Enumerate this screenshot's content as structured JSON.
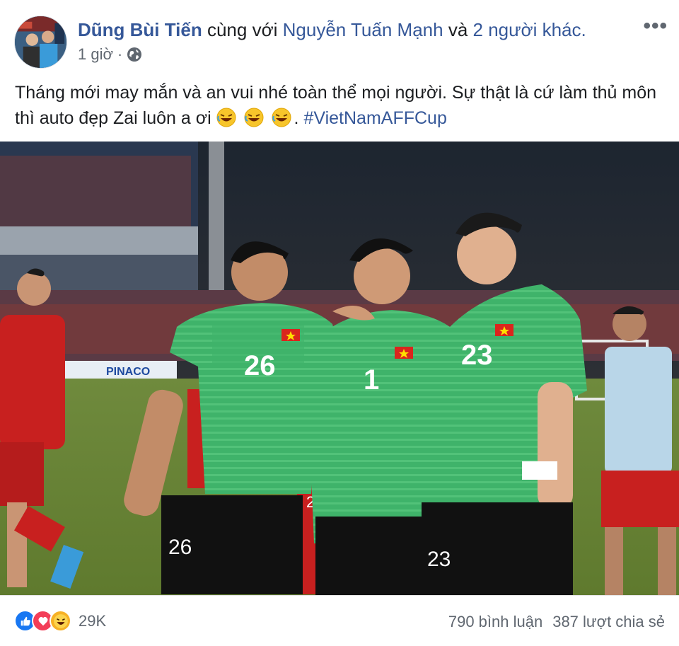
{
  "post": {
    "author": "Dũng Bùi Tiến",
    "with_word": "cùng với",
    "tagged_person": "Nguyễn Tuấn Mạnh",
    "and_word": "và",
    "others": "2 người khác.",
    "time": "1 giờ",
    "separator": "·",
    "privacy_icon": "globe-icon",
    "more_label": "•••",
    "text_line": "Tháng mới may mắn và an vui nhé toàn thể mọi người. Sự thật là cứ làm thủ môn thì auto đẹp Zai luôn a ơi",
    "emoji": [
      "rolling-laughing-emoji",
      "rolling-laughing-emoji",
      "rolling-laughing-emoji"
    ],
    "after_emoji": ".",
    "hashtag": "#VietNamAFFCup",
    "photo": {
      "icon": "photo-three-goalkeepers",
      "banner_text": "PINACO",
      "jersey_numbers": [
        "26",
        "1",
        "23"
      ],
      "shorts_numbers": [
        "26",
        "20",
        "23"
      ]
    }
  },
  "footer": {
    "reaction_icons": [
      "like-icon",
      "love-icon",
      "haha-icon"
    ],
    "reaction_count": "29K",
    "comments": "790 bình luận",
    "shares": "387 lượt chia sẻ"
  },
  "colors": {
    "link": "#365899",
    "text": "#1c1e21",
    "muted": "#606770",
    "jersey_green": "#3fb36a",
    "jersey_red": "#c8201f"
  }
}
